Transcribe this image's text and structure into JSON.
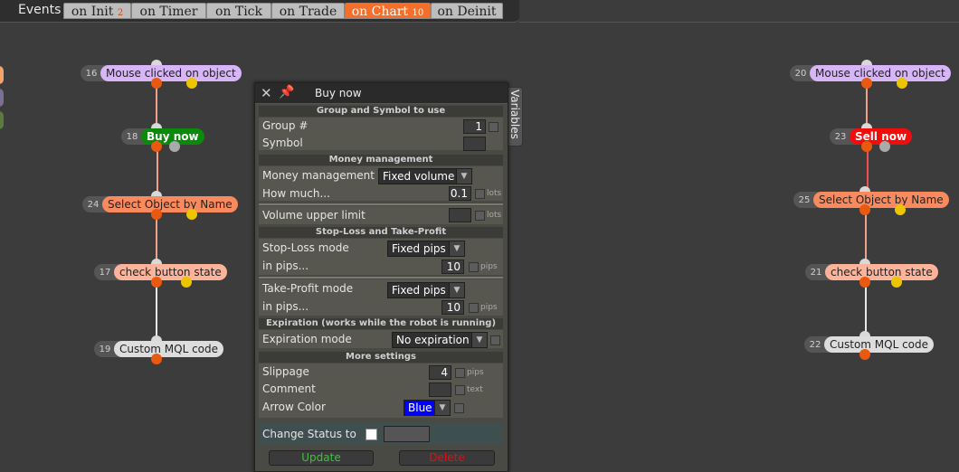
{
  "topbar": {
    "events_label": "Events",
    "tabs": [
      {
        "label": "on Init",
        "badge": "2"
      },
      {
        "label": "on Timer",
        "badge": ""
      },
      {
        "label": "on Tick",
        "badge": ""
      },
      {
        "label": "on Trade",
        "badge": ""
      },
      {
        "label": "on Chart",
        "badge": "10"
      },
      {
        "label": "on Deinit",
        "badge": ""
      }
    ],
    "active_tab": "on Chart"
  },
  "nodes": {
    "n16": {
      "id": "16",
      "label": "Mouse clicked on object"
    },
    "n18": {
      "id": "18",
      "label": "Buy now"
    },
    "n24": {
      "id": "24",
      "label": "Select Object by Name"
    },
    "n17": {
      "id": "17",
      "label": "check button state"
    },
    "n19": {
      "id": "19",
      "label": "Custom MQL code"
    },
    "n20": {
      "id": "20",
      "label": "Mouse clicked on object"
    },
    "n23": {
      "id": "23",
      "label": "Sell now"
    },
    "n25": {
      "id": "25",
      "label": "Select Object by Name"
    },
    "n21": {
      "id": "21",
      "label": "check button state"
    },
    "n22": {
      "id": "22",
      "label": "Custom MQL code"
    }
  },
  "panel": {
    "title": "Buy now",
    "variables_tab": "Variables",
    "sections": {
      "group_symbol": "Group and Symbol to use",
      "money": "Money management",
      "sltp": "Stop-Loss and Take-Profit",
      "expiration": "Expiration (works while the robot is running)",
      "more": "More settings"
    },
    "fields": {
      "group_label": "Group #",
      "group_value": "1",
      "symbol_label": "Symbol",
      "symbol_value": "",
      "mm_label": "Money management",
      "mm_value": "Fixed volume",
      "how_much_label": "How much...",
      "how_much_value": "0.1",
      "how_much_unit": "lots",
      "vol_upper_label": "Volume upper limit",
      "vol_upper_value": "",
      "vol_upper_unit": "lots",
      "sl_mode_label": "Stop-Loss mode",
      "sl_mode_value": "Fixed pips",
      "sl_pips_label": "in pips...",
      "sl_pips_value": "10",
      "sl_pips_unit": "pips",
      "tp_mode_label": "Take-Profit mode",
      "tp_mode_value": "Fixed pips",
      "tp_pips_label": "in pips...",
      "tp_pips_value": "10",
      "tp_pips_unit": "pips",
      "exp_mode_label": "Expiration mode",
      "exp_mode_value": "No expiration",
      "slippage_label": "Slippage",
      "slippage_value": "4",
      "slippage_unit": "pips",
      "comment_label": "Comment",
      "comment_value": "",
      "comment_unit": "text",
      "arrow_label": "Arrow Color",
      "arrow_value": "Blue",
      "change_status_label": "Change Status to"
    },
    "buttons": {
      "update": "Update",
      "delete": "Delete"
    }
  },
  "colors": {
    "active_tab": "#f56f2a",
    "buy_node": "#0a8a0a",
    "sell_node": "#f20d0d",
    "update_text": "#3cc23c",
    "delete_text": "#e01010",
    "arrow_color_swatch": "#0000ff"
  }
}
